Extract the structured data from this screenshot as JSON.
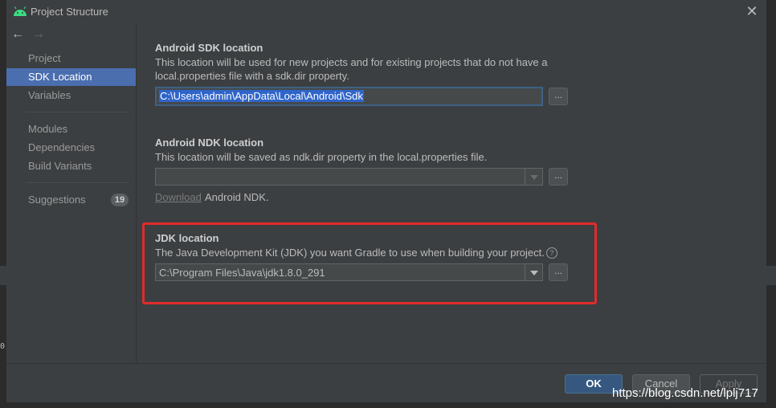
{
  "window": {
    "title": "Project Structure",
    "icon": "android-icon",
    "close_icon": "close-icon"
  },
  "nav": {
    "back": "←",
    "forward": "→"
  },
  "sidebar": {
    "items": [
      {
        "label": "Project"
      },
      {
        "label": "SDK Location",
        "selected": true
      },
      {
        "label": "Variables"
      },
      {
        "label": "Modules"
      },
      {
        "label": "Dependencies"
      },
      {
        "label": "Build Variants"
      },
      {
        "label": "Suggestions",
        "badge": "19"
      }
    ]
  },
  "sdk": {
    "title": "Android SDK location",
    "desc1": "This location will be used for new projects and for existing projects that do not have a",
    "desc2": "local.properties file with a sdk.dir property.",
    "path": "C:\\Users\\admin\\AppData\\Local\\Android\\Sdk",
    "browse": "..."
  },
  "ndk": {
    "title": "Android NDK location",
    "desc": "This location will be saved as ndk.dir property in the local.properties file.",
    "path": "",
    "browse": "...",
    "download_link": "Download",
    "download_suffix": "Android NDK."
  },
  "jdk": {
    "title": "JDK location",
    "desc": "The Java Development Kit (JDK) you want Gradle to use when building your project.",
    "help": "?",
    "path": "C:\\Program Files\\Java\\jdk1.8.0_291",
    "browse": "..."
  },
  "buttons": {
    "ok": "OK",
    "cancel": "Cancel",
    "apply": "Apply"
  },
  "watermark": "https://blog.csdn.net/lplj717",
  "ide_glyph": "0 :",
  "colors": {
    "accent": "#4b6eaf",
    "highlight": "#e12b2b",
    "selection": "#2f65ca"
  }
}
